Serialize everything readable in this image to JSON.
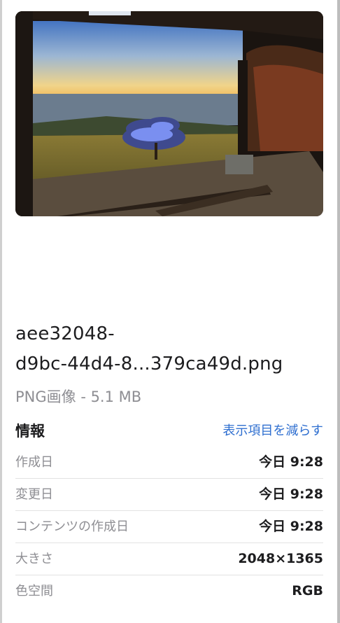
{
  "preview": {
    "icon": "image-thumbnail"
  },
  "file": {
    "name_line1": "aee32048-",
    "name_line2": "d9bc-44d4-8...379ca49d.png",
    "kind_size": "PNG画像 - 5.1 MB"
  },
  "info": {
    "title": "情報",
    "toggle_label": "表示項目を減らす",
    "rows": [
      {
        "label": "作成日",
        "value": "今日 9:28"
      },
      {
        "label": "変更日",
        "value": "今日 9:28"
      },
      {
        "label": "コンテンツの作成日",
        "value": "今日 9:28"
      },
      {
        "label": "大きさ",
        "value": "2048×1365"
      },
      {
        "label": "色空間",
        "value": "RGB"
      }
    ]
  },
  "colors": {
    "accent": "#2f6fd0",
    "secondary_text": "#8e8e93",
    "primary_text": "#1d1d1f"
  }
}
